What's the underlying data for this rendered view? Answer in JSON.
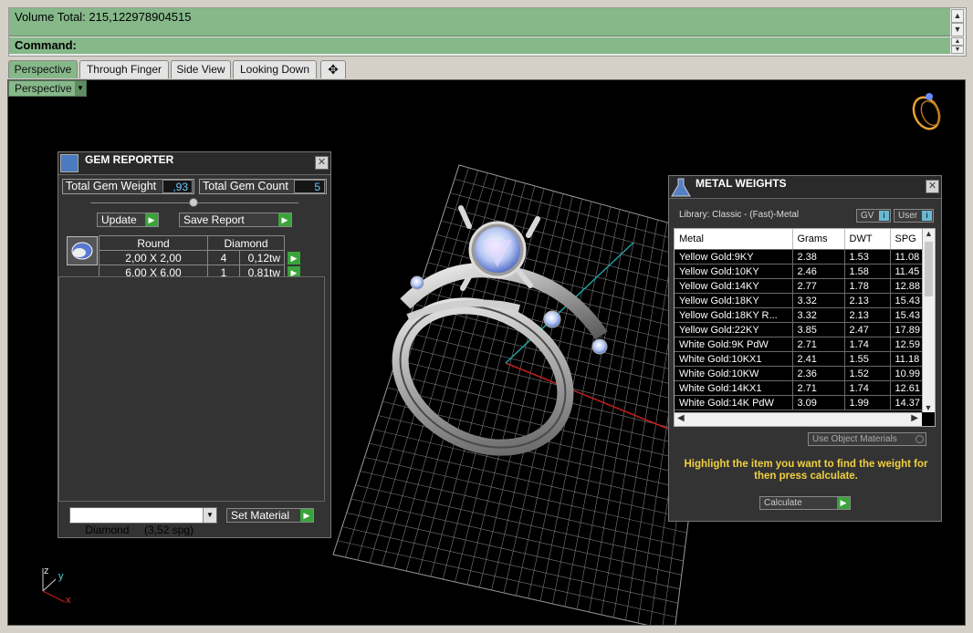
{
  "command": {
    "volume_total": "Volume Total: 215,122978904515",
    "command_label": "Command:"
  },
  "tabs": [
    "Perspective",
    "Through Finger",
    "Side View",
    "Looking Down"
  ],
  "viewport": {
    "mode": "Perspective",
    "axis": {
      "z": "z",
      "y": "y",
      "x": "x"
    }
  },
  "gem_reporter": {
    "title": "GEM REPORTER",
    "total_weight_label": "Total Gem Weight",
    "total_weight_value": ",93",
    "total_count_label": "Total Gem Count",
    "total_count_value": "5",
    "update_label": "Update",
    "save_label": "Save Report",
    "table": {
      "headers": [
        "Round",
        "Diamond"
      ],
      "rows": [
        {
          "size": "2,00 X 2,00",
          "count": "4",
          "weight": "0,12tw"
        },
        {
          "size": "6,00 X 6,00",
          "count": "1",
          "weight": "0,81tw"
        }
      ]
    },
    "material_select": "Diamond     (3,52 spg)",
    "set_material_label": "Set Material"
  },
  "metal_weights": {
    "title": "METAL WEIGHTS",
    "library": "Library: Classic - (Fast)-Metal",
    "gv_label": "GV",
    "user_label": "User",
    "headers": [
      "Metal",
      "Grams",
      "DWT",
      "SPG"
    ],
    "rows": [
      [
        "Yellow Gold:9KY",
        "2.38",
        "1.53",
        "11.08"
      ],
      [
        "Yellow Gold:10KY",
        "2.46",
        "1.58",
        "11.45"
      ],
      [
        "Yellow Gold:14KY",
        "2.77",
        "1.78",
        "12.88"
      ],
      [
        "Yellow Gold:18KY",
        "3.32",
        "2.13",
        "15.43"
      ],
      [
        "Yellow Gold:18KY R...",
        "3.32",
        "2.13",
        "15.43"
      ],
      [
        "Yellow Gold:22KY",
        "3.85",
        "2.47",
        "17.89"
      ],
      [
        "White Gold:9K PdW",
        "2.71",
        "1.74",
        "12.59"
      ],
      [
        "White Gold:10KX1",
        "2.41",
        "1.55",
        "11.18"
      ],
      [
        "White Gold:10KW",
        "2.36",
        "1.52",
        "10.99"
      ],
      [
        "White Gold:14KX1",
        "2.71",
        "1.74",
        "12.61"
      ],
      [
        "White Gold:14K PdW",
        "3.09",
        "1.99",
        "14.37"
      ]
    ],
    "use_object_materials": "Use Object Materials",
    "hint": "Highlight the item you want to find the weight for then press calculate.",
    "calculate_label": "Calculate"
  }
}
